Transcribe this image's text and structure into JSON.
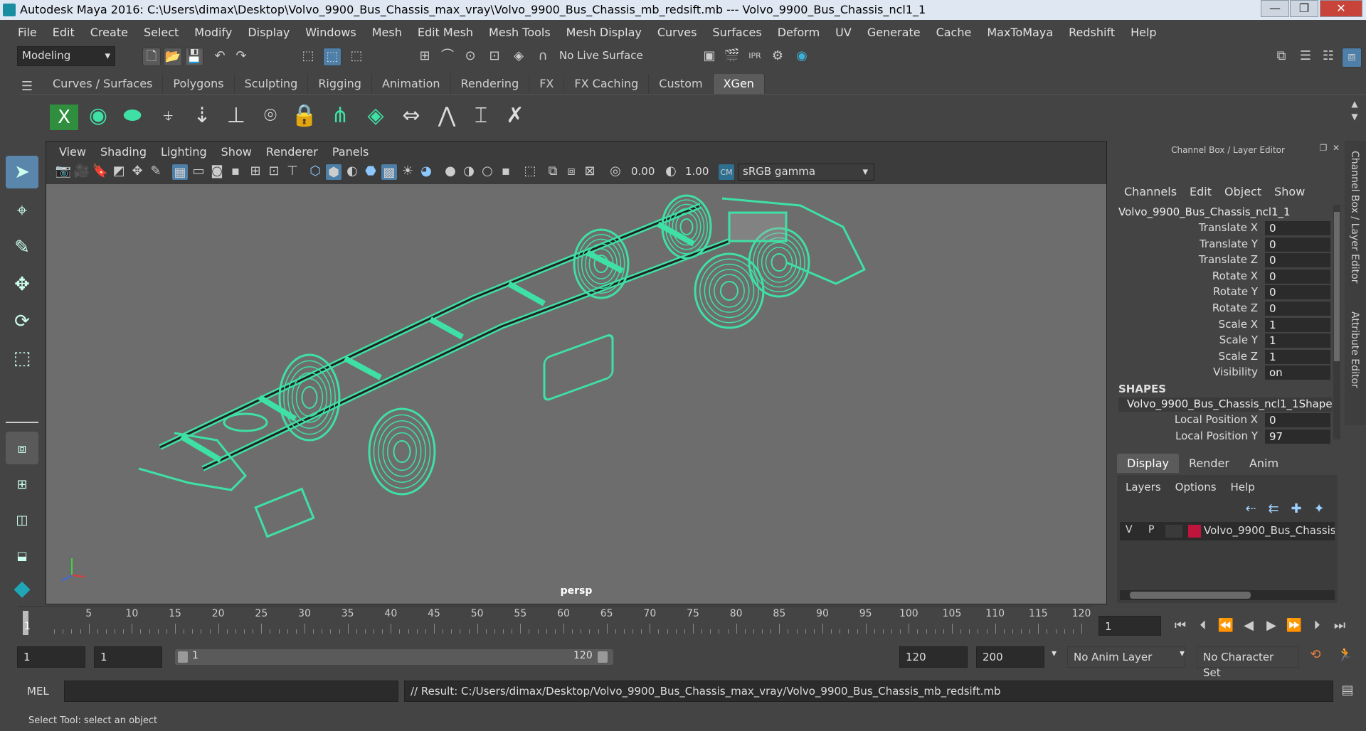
{
  "window": {
    "title": "Autodesk Maya 2016: C:\\Users\\dimax\\Desktop\\Volvo_9900_Bus_Chassis_max_vray\\Volvo_9900_Bus_Chassis_mb_redsift.mb   ---   Volvo_9900_Bus_Chassis_ncl1_1",
    "minimize": "—",
    "restore": "❐",
    "close": "✕"
  },
  "menu": [
    "File",
    "Edit",
    "Create",
    "Select",
    "Modify",
    "Display",
    "Windows",
    "Mesh",
    "Edit Mesh",
    "Mesh Tools",
    "Mesh Display",
    "Curves",
    "Surfaces",
    "Deform",
    "UV",
    "Generate",
    "Cache",
    "MaxToMaya",
    "Redshift",
    "Help"
  ],
  "status": {
    "mode": "Modeling",
    "live_surface": "No Live Surface"
  },
  "shelf": {
    "tabs": [
      "Curves / Surfaces",
      "Polygons",
      "Sculpting",
      "Rigging",
      "Animation",
      "Rendering",
      "FX",
      "FX Caching",
      "Custom",
      "XGen"
    ],
    "active_tab": "XGen"
  },
  "panel": {
    "menu": [
      "View",
      "Shading",
      "Lighting",
      "Show",
      "Renderer",
      "Panels"
    ],
    "exposure": "0.00",
    "gamma": "1.00",
    "color_space": "sRGB gamma",
    "camera": "persp"
  },
  "channel_box": {
    "header": "Channel Box / Layer Editor",
    "menu": [
      "Channels",
      "Edit",
      "Object",
      "Show"
    ],
    "object_name": "Volvo_9900_Bus_Chassis_ncl1_1",
    "attributes": [
      {
        "label": "Translate X",
        "value": "0"
      },
      {
        "label": "Translate Y",
        "value": "0"
      },
      {
        "label": "Translate Z",
        "value": "0"
      },
      {
        "label": "Rotate X",
        "value": "0"
      },
      {
        "label": "Rotate Y",
        "value": "0"
      },
      {
        "label": "Rotate Z",
        "value": "0"
      },
      {
        "label": "Scale X",
        "value": "1"
      },
      {
        "label": "Scale Y",
        "value": "1"
      },
      {
        "label": "Scale Z",
        "value": "1"
      },
      {
        "label": "Visibility",
        "value": "on"
      }
    ],
    "shapes_header": "SHAPES",
    "shape_name": "Volvo_9900_Bus_Chassis_ncl1_1Shape",
    "shape_attributes": [
      {
        "label": "Local Position X",
        "value": "0"
      },
      {
        "label": "Local Position Y",
        "value": "97"
      }
    ]
  },
  "layer_editor": {
    "tabs": [
      "Display",
      "Render",
      "Anim"
    ],
    "active_tab": "Display",
    "menu": [
      "Layers",
      "Options",
      "Help"
    ],
    "layer": {
      "v": "V",
      "p": "P",
      "name": "Volvo_9900_Bus_Chassis",
      "color": "#c0143c"
    }
  },
  "side_tabs": [
    "Channel Box / Layer Editor",
    "Attribute Editor"
  ],
  "timeline": {
    "ticks": [
      "5",
      "10",
      "15",
      "20",
      "25",
      "30",
      "35",
      "40",
      "45",
      "50",
      "55",
      "60",
      "65",
      "70",
      "75",
      "80",
      "85",
      "90",
      "95",
      "100",
      "105",
      "110",
      "115",
      "120"
    ],
    "current_marker": "1",
    "current_frame": "1"
  },
  "range": {
    "start": "1",
    "playback_start": "1",
    "slider_start": "1",
    "slider_end": "120",
    "playback_end": "120",
    "end": "200",
    "anim_layer": "No Anim Layer",
    "character_set": "No Character Set"
  },
  "command": {
    "label": "MEL",
    "result": "// Result: C:/Users/dimax/Desktop/Volvo_9900_Bus_Chassis_max_vray/Volvo_9900_Bus_Chassis_mb_redsift.mb"
  },
  "help_line": "Select Tool: select an object",
  "colors": {
    "wireframe": "#3fe0a5",
    "viewport_bg": "#6d6d6d",
    "ui_bg": "#444444"
  }
}
